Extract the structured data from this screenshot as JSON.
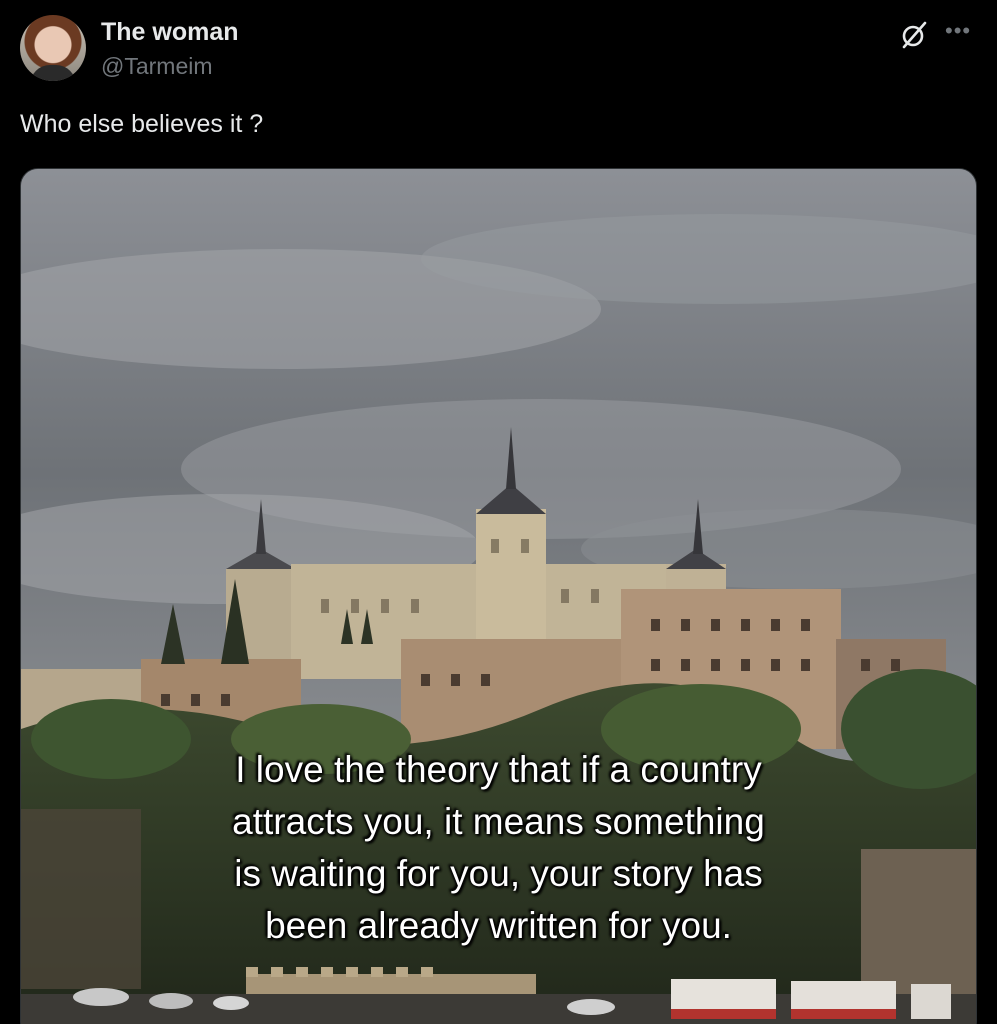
{
  "author": {
    "display_name": "The woman",
    "handle": "@Tarmeim"
  },
  "icons": {
    "grok": "grok-icon",
    "more": "more-icon",
    "avatar": "avatar"
  },
  "post": {
    "text": "Who else believes it ?"
  },
  "media": {
    "caption_lines": [
      "I love the theory that if a country",
      "attracts you, it means something",
      "is waiting for you, your story has",
      "been already written for you."
    ]
  },
  "colors": {
    "background": "#000000",
    "primary_text": "#e7e9ea",
    "secondary_text": "#71767b"
  }
}
